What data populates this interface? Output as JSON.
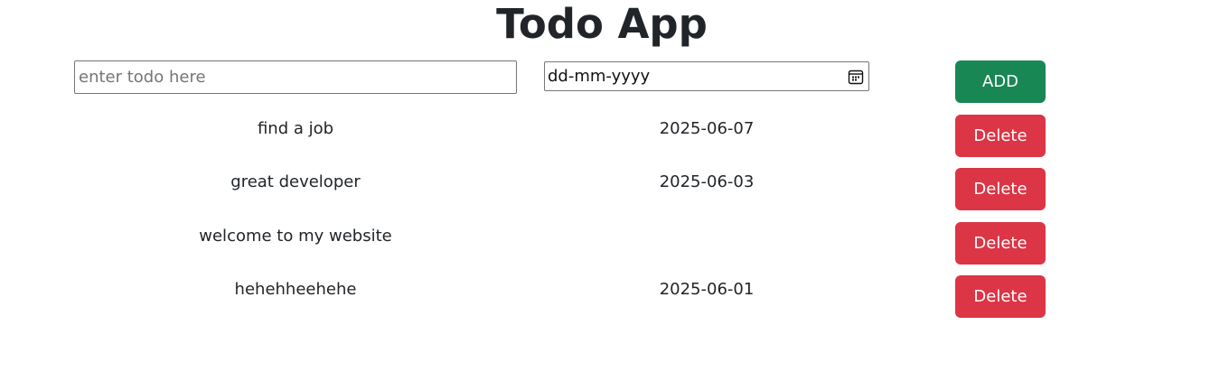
{
  "app": {
    "title": "Todo App"
  },
  "form": {
    "todo_placeholder": "enter todo here",
    "todo_value": "",
    "date_placeholder": "dd-mm-yyyy",
    "calendar_icon": "calendar-icon",
    "add_label": "ADD"
  },
  "todos": [
    {
      "name": "find a job",
      "date": "2025-06-07",
      "delete_label": "Delete"
    },
    {
      "name": "great developer",
      "date": "2025-06-03",
      "delete_label": "Delete"
    },
    {
      "name": "welcome to my website",
      "date": "",
      "delete_label": "Delete"
    },
    {
      "name": "hehehheehehe",
      "date": "2025-06-01",
      "delete_label": "Delete"
    }
  ],
  "colors": {
    "add_button": "#198754",
    "delete_button": "#dc3545",
    "text": "#212529"
  }
}
